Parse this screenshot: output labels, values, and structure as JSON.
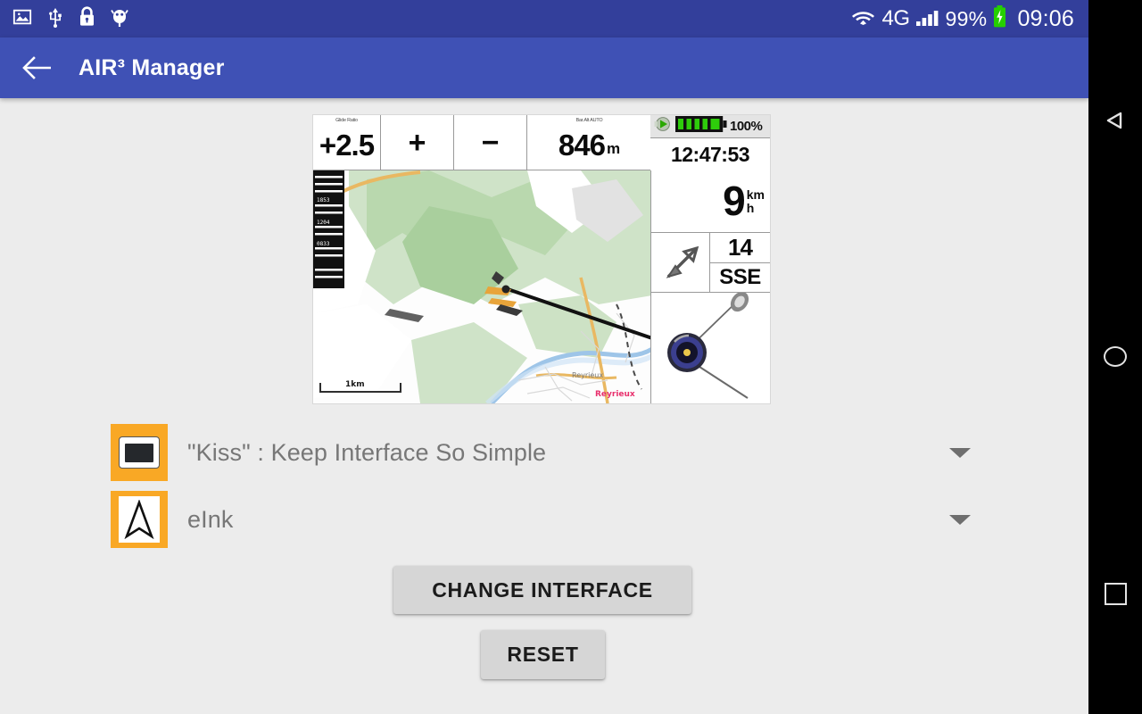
{
  "status_bar": {
    "left_icons": [
      "image-icon",
      "usb-icon",
      "lock-icon",
      "android-debug-icon"
    ],
    "network_label": "4G",
    "battery_percent": "99%",
    "clock": "09:06",
    "icons": [
      "wifi-icon",
      "signal-bars-icon",
      "battery-charging-icon"
    ],
    "background_color": "#333f9b"
  },
  "app_bar": {
    "back_label": "back-arrow",
    "title": "AIR³ Manager",
    "background_color": "#3f51b5"
  },
  "preview": {
    "alt": "AIR3 vario device interface preview",
    "top_cells": [
      {
        "mini_label": "Glide Ratio",
        "value": "+2.5"
      },
      {
        "mini_label": "",
        "value": "+"
      },
      {
        "mini_label": "",
        "value": "−"
      },
      {
        "mini_label": "Bar.Alt AUTO",
        "value": "846",
        "unit": "m"
      }
    ],
    "device_battery": "100%",
    "device_time": "12:47:53",
    "speed_value": "9",
    "speed_unit_top": "km",
    "speed_unit_bottom": "h",
    "wind_speed": "14",
    "wind_direction": "SSE",
    "map_scale": "1km",
    "map_place_label": "Reyrieux"
  },
  "selectors": [
    {
      "icon": "screen-interface-icon",
      "label": "\"Kiss\" : Keep Interface So Simple",
      "caret": "chevron-down-icon"
    },
    {
      "icon": "navigation-arrow-icon",
      "label": "eInk",
      "caret": "chevron-down-icon"
    }
  ],
  "buttons": {
    "change_interface": "CHANGE INTERFACE",
    "reset": "RESET"
  },
  "nav_bar": {
    "back": "back-triangle-icon",
    "home": "home-circle-icon",
    "recents": "recents-square-icon",
    "background_color": "#000000"
  },
  "colors": {
    "accent_orange": "#f9a825",
    "page_background": "#ececec",
    "button_gray": "#d6d6d6"
  }
}
